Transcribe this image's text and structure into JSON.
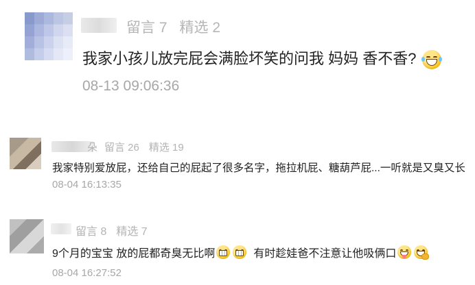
{
  "comments": [
    {
      "meta": {
        "messages": "留言 7",
        "featured": "精选 2"
      },
      "text": "我家小孩儿放完屁会满脸坏笑的问我 妈妈 香不香?",
      "emoji_icon": "laughing-tears-emoji-icon",
      "time": "08-13 09:06:36"
    },
    {
      "name_visible_suffix": "朵",
      "meta": {
        "messages": "留言 26",
        "featured": "精选 19"
      },
      "text": "我家特别爱放屁，还给自己的屁起了很多名字，拖拉机屁、糖葫芦屁...一听就是又臭又长",
      "time": "08-04 16:13:35"
    },
    {
      "meta": {
        "messages": "留言 8",
        "featured": "精选 7"
      },
      "text_part1": "9个月的宝宝 放的屁都奇臭无比啊",
      "text_part2": "有时趁娃爸不注意让他吸俩口",
      "emoji_icons": [
        "grin-emoji-icon",
        "grin-emoji-icon",
        "tongue-out-emoji-icon",
        "hand-over-mouth-emoji-icon"
      ],
      "time": "08-04 16:27:52"
    }
  ]
}
